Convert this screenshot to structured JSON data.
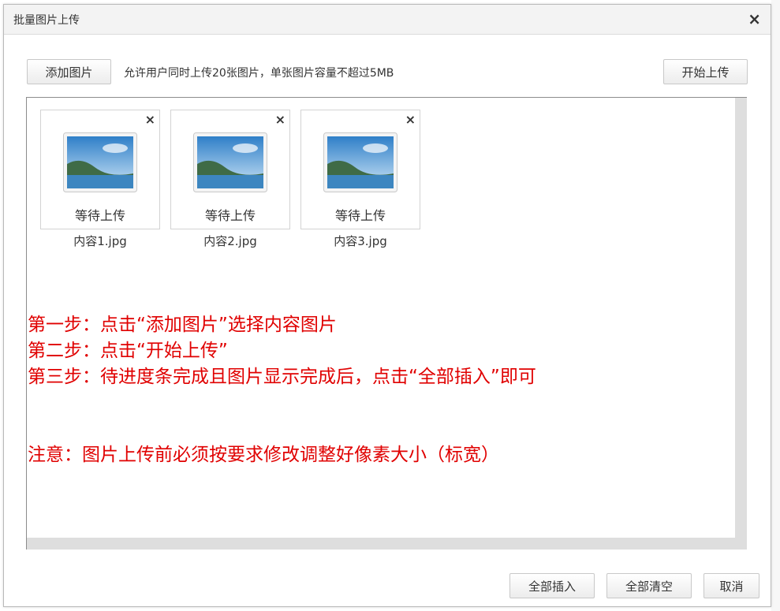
{
  "dialog": {
    "title": "批量图片上传",
    "close_glyph": "×"
  },
  "toolbar": {
    "add_label": "添加图片",
    "hint": "允许用户同时上传20张图片，单张图片容量不超过5MB",
    "start_label": "开始上传"
  },
  "files": [
    {
      "status": "等待上传",
      "name": "内容1.jpg"
    },
    {
      "status": "等待上传",
      "name": "内容2.jpg"
    },
    {
      "status": "等待上传",
      "name": "内容3.jpg"
    }
  ],
  "remove_glyph": "×",
  "instructions": {
    "step1": "第一步：点击“添加图片”选择内容图片",
    "step2": "第二步：点击“开始上传”",
    "step3": "第三步：待进度条完成且图片显示完成后，点击“全部插入”即可",
    "note": "注意：图片上传前必须按要求修改调整好像素大小（标宽）"
  },
  "footer": {
    "insert_all": "全部插入",
    "clear_all": "全部清空",
    "cancel": "取消"
  }
}
